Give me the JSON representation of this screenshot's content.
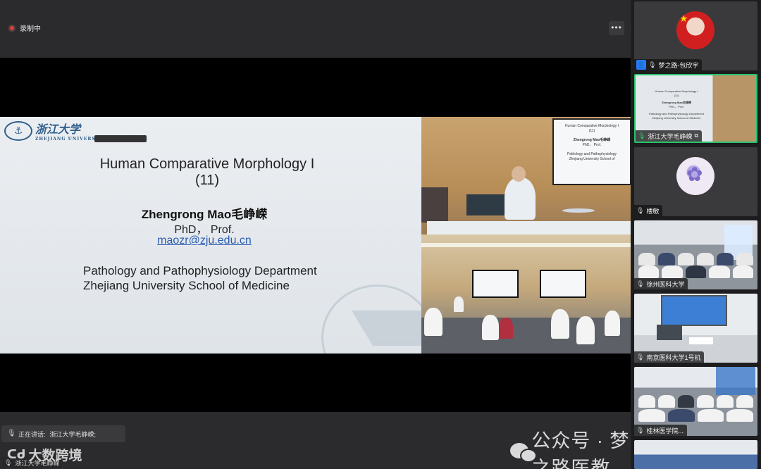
{
  "app": {
    "recording_label": "录制中",
    "more_label": "•••"
  },
  "slide": {
    "logo_cn": "浙江大学",
    "logo_en": "ZHEJIANG UNIVERSITY",
    "title_line1": "Human  Comparative  Morphology I",
    "title_line2": "(11)",
    "author": "Zhengrong Mao毛峥嵘",
    "degree": "PhD，  Prof.",
    "email": "maozr@zju.edu.cn",
    "dept_line1": "Pathology and Pathophysiology Department",
    "dept_line2": " Zhejiang University School of Medicine"
  },
  "camera": {
    "screen_title": "Human Comparative  Morphology I",
    "screen_sub": "(11)",
    "screen_author": "Zhengrong Mao毛峥嵘",
    "screen_degree": "PhD，  Prof.",
    "screen_dept1": "Pathology and Pathophysiology",
    "screen_dept2": "Zhejiang University School of"
  },
  "speaking": {
    "label": "正在讲话:",
    "name": "浙江大学毛峥嵘;"
  },
  "self": {
    "name": "浙江大学毛峥嵘"
  },
  "watermarks": {
    "left_brand": "大数跨境",
    "right_brand": "公众号 · 梦之路医教"
  },
  "participants": [
    {
      "name": "梦之路-包欣宇",
      "type": "avatar-red",
      "badge": "user-icon"
    },
    {
      "name": "浙江大学毛峥嵘",
      "type": "slide",
      "active": true
    },
    {
      "name": "楼敏",
      "type": "avatar-flower"
    },
    {
      "name": "徐州医科大学",
      "type": "classroom"
    },
    {
      "name": "南京医科大学1号机",
      "type": "lab"
    },
    {
      "name": "桂林医学院...",
      "type": "classroom2"
    }
  ],
  "colors": {
    "active_border": "#27c46a",
    "record_dot": "#e53935",
    "email_link": "#2a5db0"
  }
}
